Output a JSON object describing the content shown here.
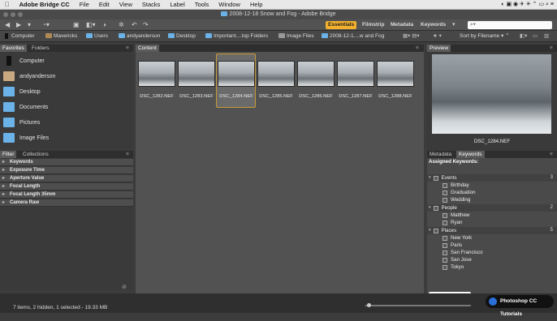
{
  "menubar": {
    "app": "Adobe Bridge CC",
    "items": [
      "File",
      "Edit",
      "View",
      "Stacks",
      "Label",
      "Tools",
      "Window",
      "Help"
    ]
  },
  "window": {
    "title": "2008-12-18 Snow and Fog - Adobe Bridge"
  },
  "workspaces": {
    "active": "Essentials",
    "items": [
      "Filmstrip",
      "Metadata",
      "Keywords"
    ]
  },
  "search": {
    "placeholder": "⌕▾"
  },
  "path": [
    "Computer",
    "Mavericks",
    "Users",
    "andyanderson",
    "Desktop",
    "Important....top Folders",
    "Image Files",
    "2008-12-1....w and Fog"
  ],
  "sort": {
    "label": "Sort by Filename"
  },
  "favorites": {
    "tabs": [
      "Favorites",
      "Folders"
    ],
    "items": [
      "Computer",
      "andyanderson",
      "Desktop",
      "Documents",
      "Pictures",
      "Image Files"
    ]
  },
  "filter": {
    "tabs": [
      "Filter",
      "Collections"
    ],
    "rows": [
      "Keywords",
      "Exposure Time",
      "Aperture Value",
      "Focal Length",
      "Focal Length 35mm",
      "Camera Raw"
    ]
  },
  "content": {
    "tab": "Content",
    "thumbs": [
      "DSC_1282.NEF",
      "DSC_1283.NEF",
      "DSC_1284.NEF",
      "DSC_1285.NEF",
      "DSC_1286.NEF",
      "DSC_1287.NEF",
      "DSC_1288.NEF"
    ]
  },
  "preview": {
    "tab": "Preview",
    "caption": "DSC_1284.NEF"
  },
  "keywordsPanel": {
    "tabs": [
      "Metadata",
      "Keywords"
    ],
    "assigned": "Assigned Keywords:",
    "groups": [
      {
        "name": "Events",
        "count": "3",
        "items": [
          "Birthday",
          "Graduation",
          "Wedding"
        ]
      },
      {
        "name": "People",
        "count": "2",
        "items": [
          "Matthew",
          "Ryan"
        ]
      },
      {
        "name": "Places",
        "count": "5",
        "items": [
          "New York",
          "Paris",
          "San Francisco",
          "San Jose",
          "Tokyo"
        ]
      }
    ]
  },
  "status": {
    "text": "7 items, 2 hidden, 1 selected - 19.33 MB"
  },
  "watermark": "Photoshop CC Tutorials"
}
